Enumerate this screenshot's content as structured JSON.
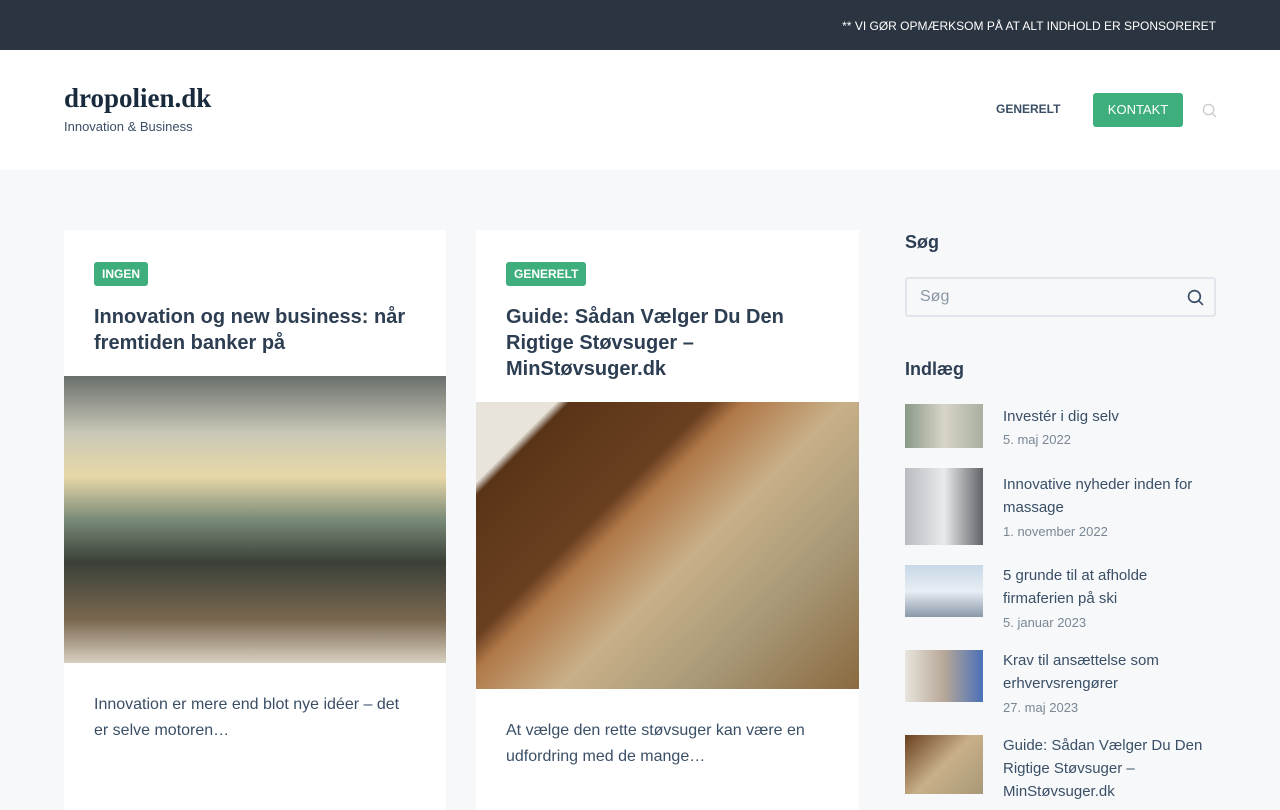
{
  "topbar": {
    "notice": "** VI GØR OPMÆRKSOM PÅ AT ALT INDHOLD ER SPONSORERET"
  },
  "header": {
    "site_title": "dropolien.dk",
    "tagline": "Innovation & Business",
    "nav": [
      {
        "label": "GENERELT"
      },
      {
        "label": "KONTAKT"
      }
    ]
  },
  "cards": [
    {
      "category": "INGEN",
      "title": "Innovation og new business: når fremtiden banker på",
      "excerpt": "Innovation er mere end blot nye idéer – det er selve motoren…"
    },
    {
      "category": "GENERELT",
      "title": "Guide: Sådan Vælger Du Den Rigtige Støvsuger – MinStøvsuger.dk",
      "excerpt": "At vælge den rette støvsuger kan være en udfordring med de mange…"
    }
  ],
  "sidebar": {
    "search_heading": "Søg",
    "search_placeholder": "Søg",
    "posts_heading": "Indlæg",
    "posts": [
      {
        "title": "Investér i dig selv",
        "date": "5. maj 2022"
      },
      {
        "title": "Innovative nyheder inden for massage",
        "date": "1. november 2022"
      },
      {
        "title": "5 grunde til at afholde firmaferien på ski",
        "date": "5. januar 2023"
      },
      {
        "title": "Krav til ansættelse som erhvervsrengører",
        "date": "27. maj 2023"
      },
      {
        "title": "Guide: Sådan Vælger Du Den Rigtige Støvsuger – MinStøvsuger.dk",
        "date": ""
      }
    ]
  },
  "colors": {
    "accent": "#3eaf7c",
    "topbar": "#2b3541"
  }
}
